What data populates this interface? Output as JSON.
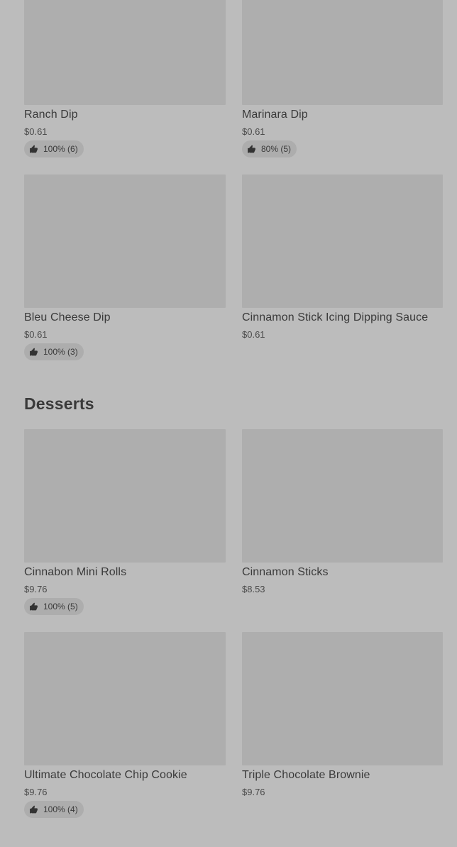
{
  "sides_section": {
    "items": [
      {
        "name": "Ranch Dip",
        "price": "$0.61",
        "rating": "100% (6)"
      },
      {
        "name": "Marinara Dip",
        "price": "$0.61",
        "rating": "80% (5)"
      },
      {
        "name": "Bleu Cheese Dip",
        "price": "$0.61",
        "rating": "100% (3)"
      },
      {
        "name": "Cinnamon Stick Icing Dipping Sauce",
        "price": "$0.61"
      }
    ]
  },
  "desserts_section": {
    "title": "Desserts",
    "items": [
      {
        "name": "Cinnabon Mini Rolls",
        "price": "$9.76",
        "rating": "100% (5)"
      },
      {
        "name": "Cinnamon Sticks",
        "price": "$8.53"
      },
      {
        "name": "Ultimate Chocolate Chip Cookie",
        "price": "$9.76",
        "rating": "100% (4)"
      },
      {
        "name": "Triple Chocolate Brownie",
        "price": "$9.76"
      }
    ]
  },
  "icons": {
    "rating": "thumbs-up-icon"
  }
}
